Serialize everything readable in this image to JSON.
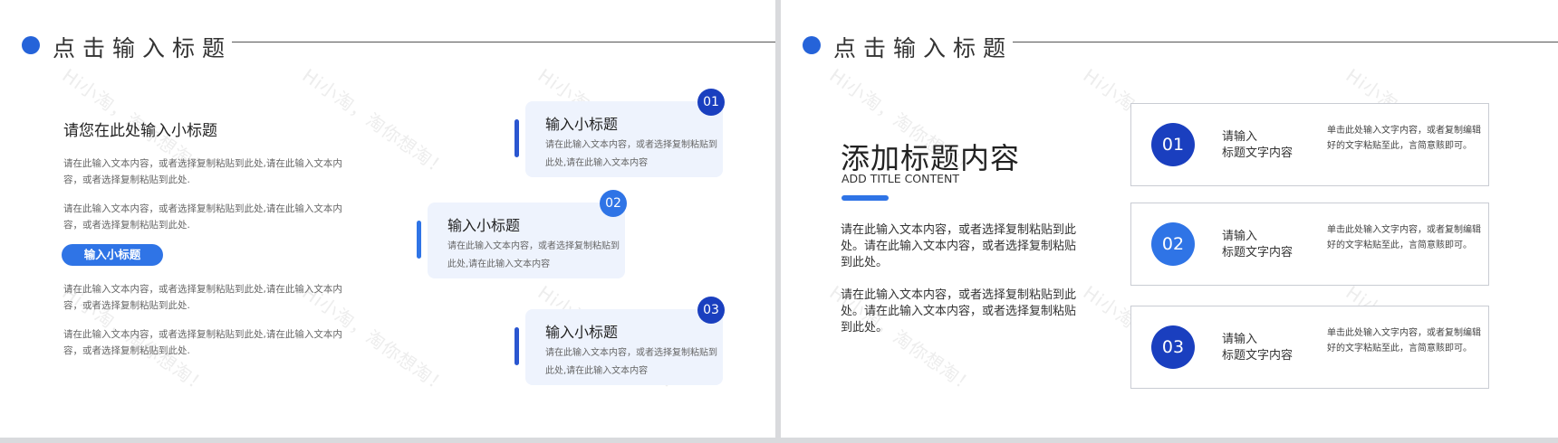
{
  "watermark": "Hi小淘，淘你想淘！",
  "left_slide": {
    "title": "点击输入标题",
    "subheading": "请您在此处输入小标题",
    "paragraphs": [
      "请在此输入文本内容，或者选择复制粘贴到此处,请在此输入文本内容，或者选择复制粘贴到此处.",
      "请在此输入文本内容，或者选择复制粘贴到此处,请在此输入文本内容，或者选择复制粘贴到此处.",
      "请在此输入文本内容，或者选择复制粘贴到此处,请在此输入文本内容，或者选择复制粘贴到此处.",
      "请在此输入文本内容，或者选择复制粘贴到此处,请在此输入文本内容，或者选择复制粘贴到此处."
    ],
    "pill_label": "输入小标题",
    "cards": [
      {
        "number": "01",
        "title": "输入小标题",
        "text": "请在此输入文本内容，或者选择复制粘贴到此处,请在此输入文本内容"
      },
      {
        "number": "02",
        "title": "输入小标题",
        "text": "请在此输入文本内容，或者选择复制粘贴到此处,请在此输入文本内容"
      },
      {
        "number": "03",
        "title": "输入小标题",
        "text": "请在此输入文本内容，或者选择复制粘贴到此处,请在此输入文本内容"
      }
    ]
  },
  "right_slide": {
    "title": "点击输入标题",
    "big_title": "添加标题内容",
    "en_title": "ADD TITLE CONTENT",
    "paragraphs": [
      "请在此输入文本内容，或者选择复制粘贴到此处。请在此输入文本内容，或者选择复制粘贴到此处。",
      "请在此输入文本内容，或者选择复制粘贴到此处。请在此输入文本内容，或者选择复制粘贴到此处。"
    ],
    "items": [
      {
        "number": "01",
        "label_line1": "请输入",
        "label_line2": "标题文字内容",
        "desc": "单击此处输入文字内容，或者复制编辑好的文字粘贴至此，言简意赅即可。"
      },
      {
        "number": "02",
        "label_line1": "请输入",
        "label_line2": "标题文字内容",
        "desc": "单击此处输入文字内容，或者复制编辑好的文字粘贴至此，言简意赅即可。"
      },
      {
        "number": "03",
        "label_line1": "请输入",
        "label_line2": "标题文字内容",
        "desc": "单击此处输入文字内容，或者复制编辑好的文字粘贴至此，言简意赅即可。"
      }
    ]
  },
  "colors": {
    "primary": "#2563d9",
    "badge_dark": "#1a3fbf",
    "badge_mid": "#2f74e6",
    "card_bg": "#eef3fd"
  }
}
